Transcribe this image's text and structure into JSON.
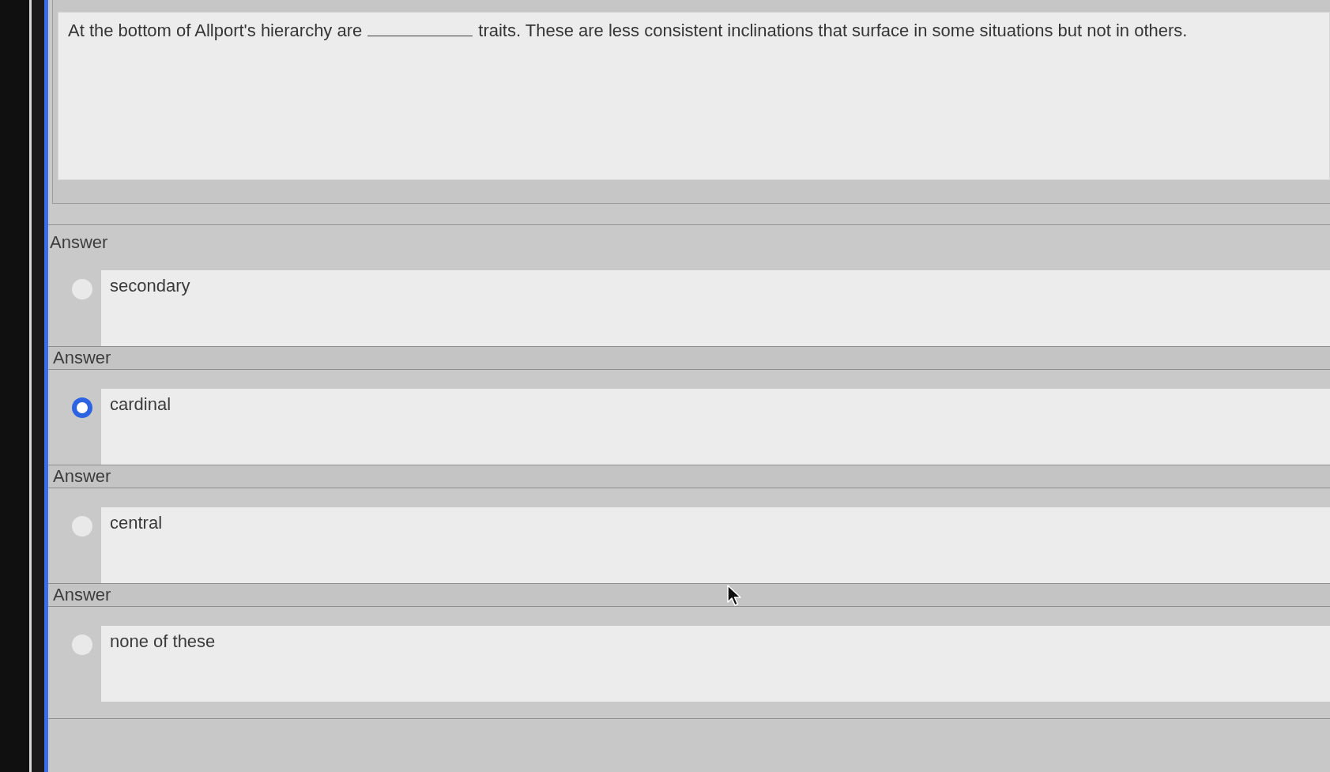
{
  "question": {
    "parts": [
      "At the bottom of Allport's hierarchy are",
      "traits. These are less consistent inclinations that surface in some situations but not in others."
    ]
  },
  "answers": [
    {
      "label": "Answer",
      "text": "secondary",
      "selected": false
    },
    {
      "label": "Answer",
      "text": "cardinal",
      "selected": true
    },
    {
      "label": "Answer",
      "text": "central",
      "selected": false
    },
    {
      "label": "Answer",
      "text": "none of these",
      "selected": false
    }
  ]
}
